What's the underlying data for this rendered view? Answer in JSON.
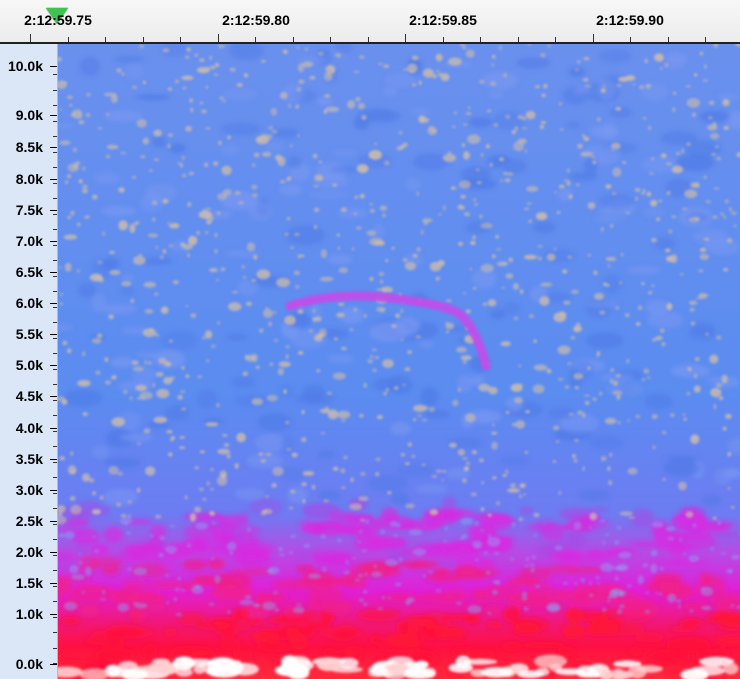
{
  "timeline": {
    "labels": [
      "2:12:59.75",
      "2:12:59.80",
      "2:12:59.85",
      "2:12:59.90"
    ]
  },
  "frequency_axis": {
    "labels": [
      "10.0k",
      "9.0k",
      "8.5k",
      "8.0k",
      "7.5k",
      "7.0k",
      "6.5k",
      "6.0k",
      "5.5k",
      "5.0k",
      "4.5k",
      "4.0k",
      "3.5k",
      "3.0k",
      "2.5k",
      "2.0k",
      "1.5k",
      "1.0k",
      "0.0k"
    ]
  },
  "playhead": {
    "icon": "playhead-triangle-icon"
  },
  "colors": {
    "background_spectrum": "#5b8cf0",
    "noise_speckle": "#c9b9a8",
    "mid_energy": "#e020d8",
    "high_energy": "#ff1040",
    "peak_energy": "#ffffff",
    "call_trace": "#b04ee8",
    "playhead": "#3fc251"
  }
}
